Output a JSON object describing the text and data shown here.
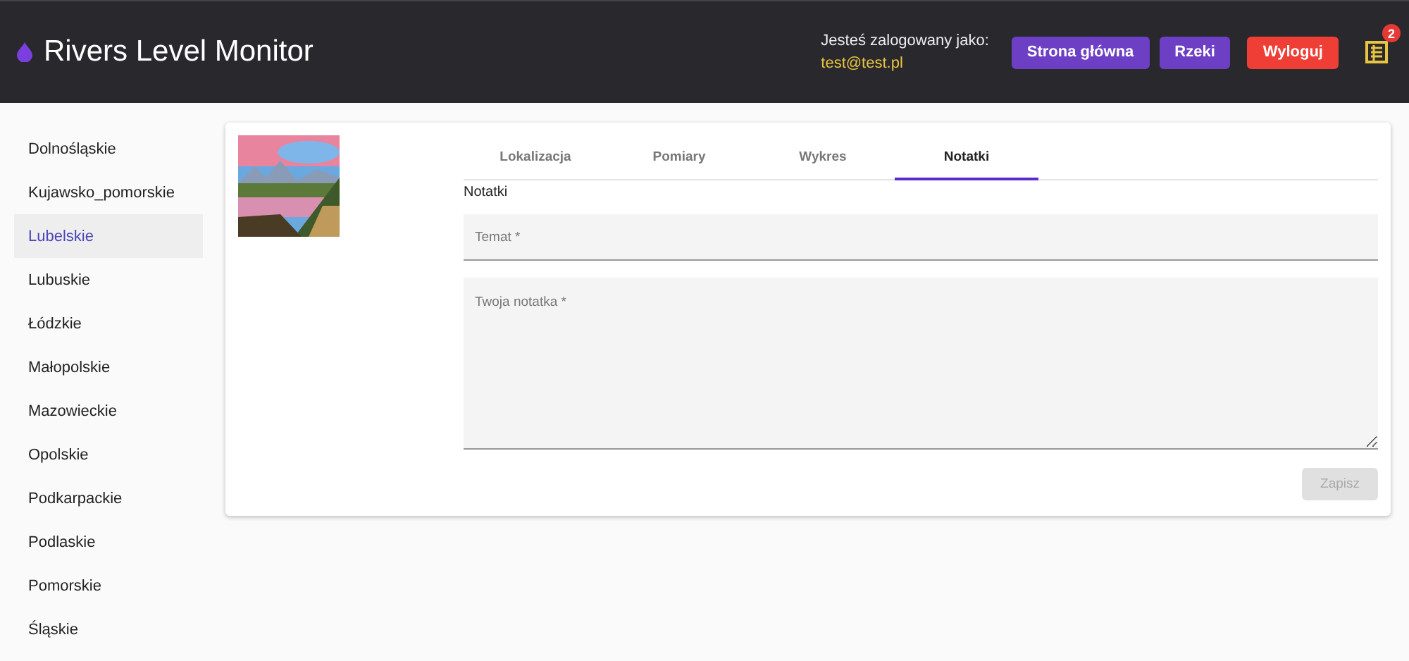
{
  "header": {
    "title": "Rivers Level Monitor",
    "login_label": "Jesteś zalogowany jako:",
    "user_email": "test@test.pl",
    "buttons": [
      {
        "label": "Strona główna",
        "kind": "primary"
      },
      {
        "label": "Rzeki",
        "kind": "primary"
      },
      {
        "label": "Wyloguj",
        "kind": "danger"
      }
    ],
    "notifications_badge": "2"
  },
  "sidebar": {
    "items": [
      {
        "label": "Dolnośląskie",
        "selected": false
      },
      {
        "label": "Kujawsko_pomorskie",
        "selected": false
      },
      {
        "label": "Lubelskie",
        "selected": true
      },
      {
        "label": "Lubuskie",
        "selected": false
      },
      {
        "label": "Łódzkie",
        "selected": false
      },
      {
        "label": "Małopolskie",
        "selected": false
      },
      {
        "label": "Mazowieckie",
        "selected": false
      },
      {
        "label": "Opolskie",
        "selected": false
      },
      {
        "label": "Podkarpackie",
        "selected": false
      },
      {
        "label": "Podlaskie",
        "selected": false
      },
      {
        "label": "Pomorskie",
        "selected": false
      },
      {
        "label": "Śląskie",
        "selected": false
      }
    ]
  },
  "card": {
    "tabs": [
      {
        "label": "Lokalizacja",
        "selected": false
      },
      {
        "label": "Pomiary",
        "selected": false
      },
      {
        "label": "Wykres",
        "selected": false
      },
      {
        "label": "Notatki",
        "selected": true
      }
    ],
    "section_title": "Notatki",
    "subject_field": {
      "placeholder": "Temat *"
    },
    "note_field": {
      "placeholder": "Twoja notatka *"
    },
    "save_button": {
      "label": "Zapisz",
      "disabled": true
    }
  }
}
